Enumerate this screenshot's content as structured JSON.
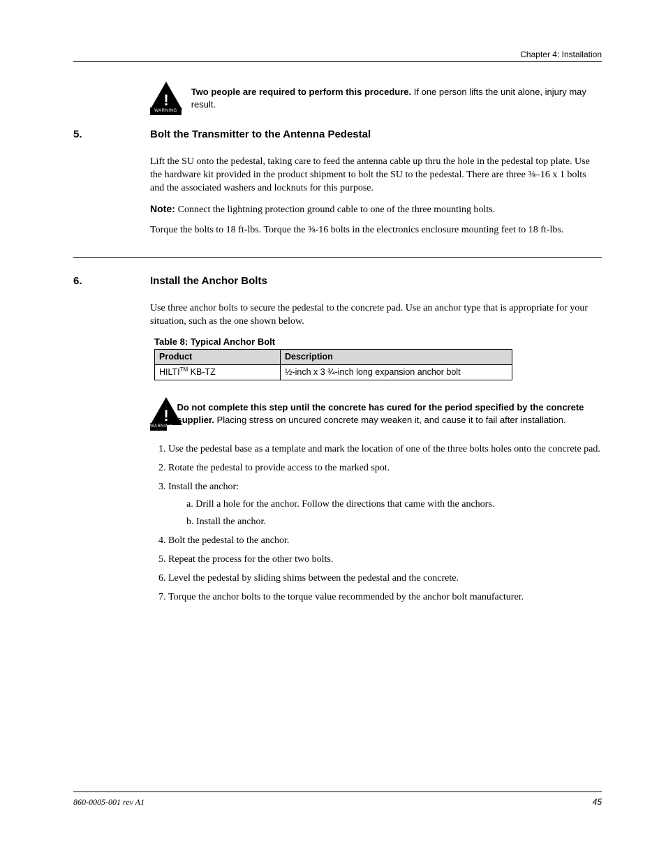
{
  "header": {
    "running_title": "Chapter 4: Installation"
  },
  "warning1": {
    "label": "WARNING",
    "text_bold_prefix": "Two people are required to perform this procedure.",
    "text_rest": " If one person lifts the unit alone, injury may result."
  },
  "step5": {
    "num": "5.",
    "title": "Bolt the Transmitter to the Antenna Pedestal",
    "line1_a": "Lift the SU onto the pedestal, taking care to feed the antenna cable up thru the hole in the pedestal top plate. Use the hardware kit provided in the product shipment to bolt the SU to the pedestal. There are three ",
    "line1_b": "⅜–16 x 1",
    "line1_c": " bolts and the associated washers and locknuts for this purpose.",
    "line2_a": "Note: ",
    "line2_b": "Connect the lightning protection ground cable to one of the three mounting bolts.",
    "line3_a": "Torque the bolts to 18 ft-lbs. Torque the ",
    "line3_b": "⅜-16",
    "line3_c": " bolts in the electronics enclosure mounting feet to 18 ft-lbs."
  },
  "step6": {
    "num": "6.",
    "title": "Install the Anchor Bolts",
    "para": "Use three anchor bolts to secure the pedestal to the concrete pad. Use an anchor type that is appropriate for your situation, such as the one shown below.",
    "table": {
      "caption": "Table 8: Typical Anchor Bolt",
      "headers": [
        "Product",
        "Description"
      ],
      "row": {
        "product_a": "HILTI",
        "product_tm": "TM",
        "product_b": " KB-TZ",
        "desc": "½-inch x 3 ¾-inch long expansion anchor bolt"
      }
    },
    "warn": {
      "label": "WARNING",
      "text_bold": "Do not complete this step until the concrete has cured for the period specified by the concrete supplier.",
      "text_rest": " Placing stress on uncured concrete may weaken it, and cause it to fail after installation."
    },
    "steps": {
      "s1": "Use the pedestal base as a template and mark the location of one of the three bolts holes onto the concrete pad.",
      "s2": "Rotate the pedestal to provide access to the marked spot.",
      "s3": "Install the anchor:",
      "s3a": "Drill a hole for the anchor. Follow the directions that came with the anchors.",
      "s3b": "Install the anchor.",
      "s4": "Bolt the pedestal to the anchor.",
      "s5": "Repeat the process for the other two bolts.",
      "s6": "Level the pedestal by sliding shims between the pedestal and the concrete.",
      "s7": "Torque the anchor bolts to the torque value recommended by the anchor bolt manufacturer."
    }
  },
  "footer": {
    "left": "860-0005-001 rev A1",
    "right": "45"
  }
}
